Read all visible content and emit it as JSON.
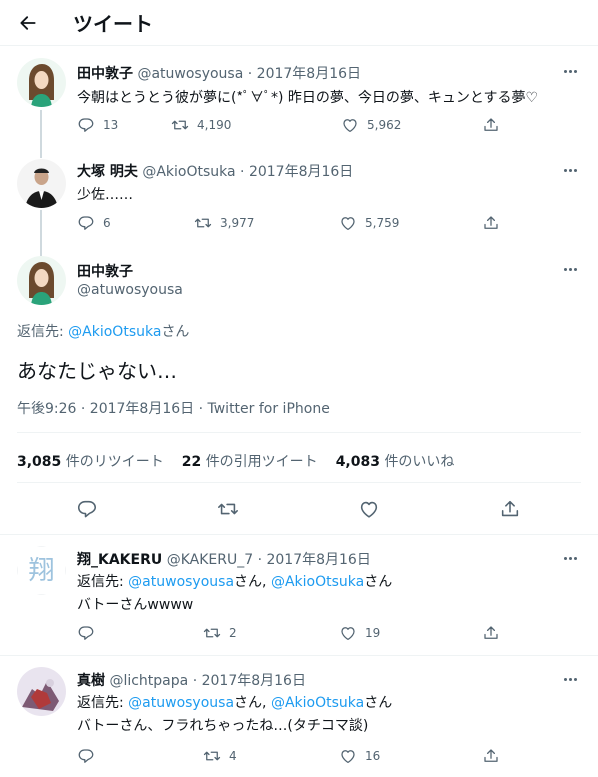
{
  "header": {
    "title": "ツイート"
  },
  "tweets": [
    {
      "name": "田中敦子",
      "handle": "@atuwosyousa",
      "date": "2017年8月16日",
      "text": "今朝はとうとう彼が夢に(*ﾟ∀ﾟ*) 昨日の夢、今日の夢、キュンとする夢♡",
      "replies": "13",
      "retweets": "4,190",
      "likes": "5,962"
    },
    {
      "name": "大塚 明夫",
      "handle": "@AkioOtsuka",
      "date": "2017年8月16日",
      "text": "少佐……",
      "replies": "6",
      "retweets": "3,977",
      "likes": "5,759"
    }
  ],
  "main": {
    "name": "田中敦子",
    "handle": "@atuwosyousa",
    "reply_prefix": "返信先: ",
    "reply_to": "@AkioOtsuka",
    "reply_suffix": "さん",
    "body": "あなたじゃない…",
    "timestamp": "午後9:26 · 2017年8月16日 · Twitter for iPhone",
    "stats": [
      {
        "count": "3,085",
        "label": "件のリツイート"
      },
      {
        "count": "22",
        "label": "件の引用ツイート"
      },
      {
        "count": "4,083",
        "label": "件のいいね"
      }
    ]
  },
  "replies": [
    {
      "name": "翔_KAKERU",
      "handle": "@KAKERU_7",
      "date": "2017年8月16日",
      "reply_prefix": "返信先: ",
      "reply_a": "@atuwosyousa",
      "reply_mid": "さん, ",
      "reply_b": "@AkioOtsuka",
      "reply_suffix": "さん",
      "text": "バトーさんwwww",
      "replies": "",
      "retweets": "2",
      "likes": "19"
    },
    {
      "name": "真樹",
      "handle": "@lichtpapa",
      "date": "2017年8月16日",
      "reply_prefix": "返信先: ",
      "reply_a": "@atuwosyousa",
      "reply_mid": "さん, ",
      "reply_b": "@AkioOtsuka",
      "reply_suffix": "さん",
      "text": "バトーさん、フラれちゃったね…(タチコマ談)",
      "replies": "",
      "retweets": "4",
      "likes": "16"
    }
  ],
  "icons": {
    "back": "arrow-left-icon",
    "more": "more-icon",
    "reply": "reply-icon",
    "retweet": "retweet-icon",
    "like": "heart-icon",
    "share": "share-icon"
  },
  "colors": {
    "link": "#1d9bf0",
    "muted": "#536471",
    "border": "#eff3f4"
  }
}
